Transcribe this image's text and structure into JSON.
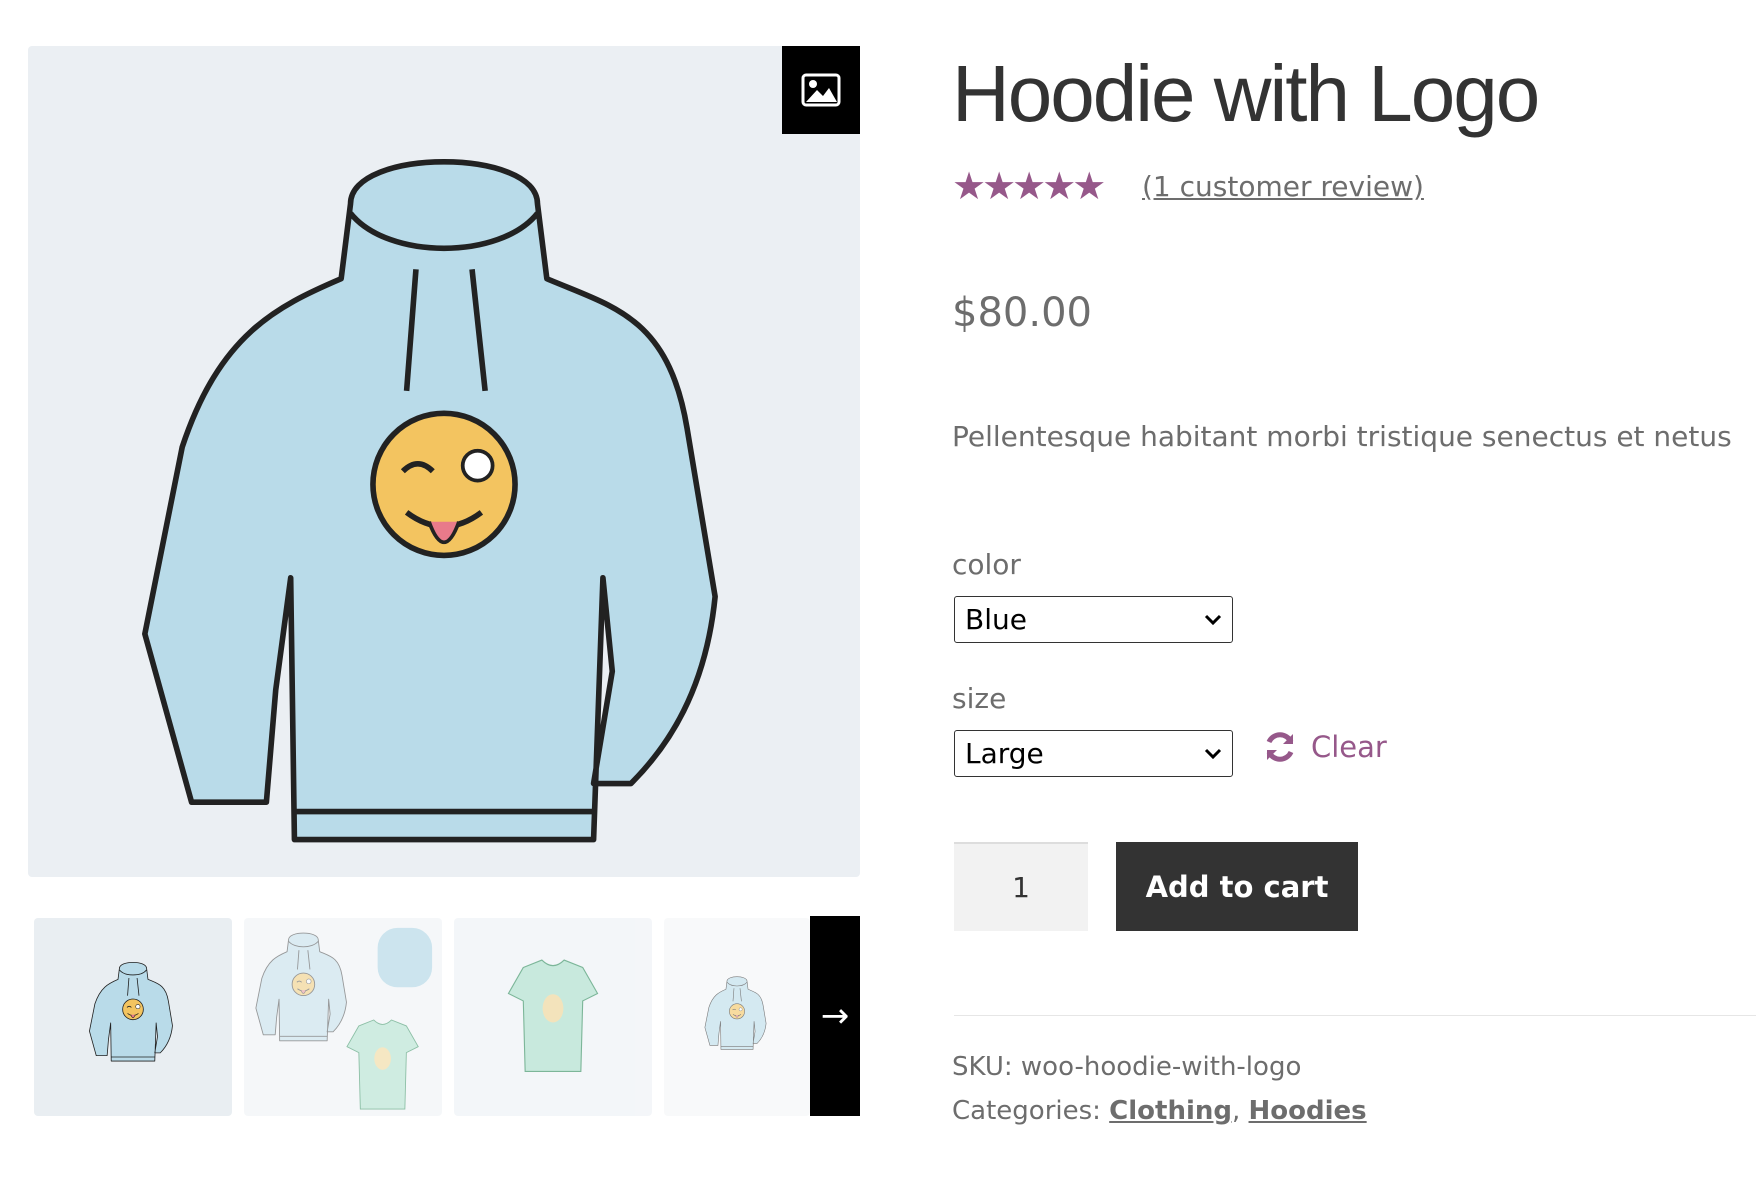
{
  "product": {
    "title": "Hoodie with Logo",
    "rating": 5,
    "rating_max": 5,
    "stars": "★★★★★",
    "review_link": "(1 customer review)",
    "price": "$80.00",
    "description": "Pellentesque habitant morbi tristique senectus et netus"
  },
  "variations": {
    "color_label": "color",
    "color_value": "Blue",
    "size_label": "size",
    "size_value": "Large",
    "clear_label": "Clear"
  },
  "cart": {
    "quantity": "1",
    "add_to_cart_label": "Add to cart"
  },
  "meta": {
    "sku_label": "SKU:",
    "sku_value": "woo-hoodie-with-logo",
    "categories_label": "Categories:",
    "categories": [
      "Clothing",
      "Hoodies"
    ],
    "separator": ","
  },
  "gallery": {
    "thumbnails": [
      "hoodie",
      "hoodie-beanie-tshirt",
      "tshirt",
      "hoodie-faded"
    ],
    "zoom_icon": "image-icon",
    "next_icon": "arrow-right-icon",
    "next_glyph": "→"
  },
  "colors": {
    "accent": "#96588a",
    "button": "#333333",
    "image_bg": "#ebeff3"
  }
}
